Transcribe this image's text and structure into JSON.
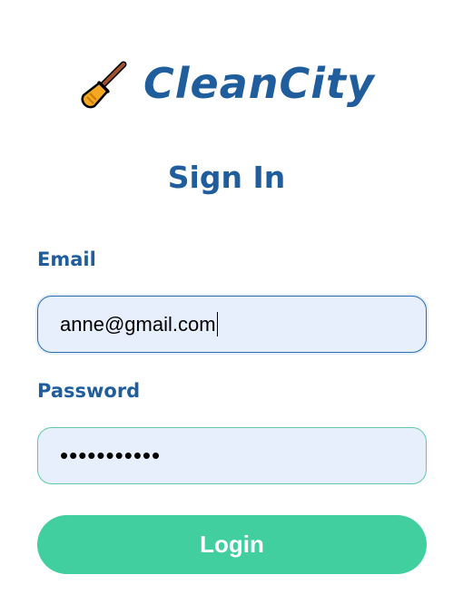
{
  "brand": {
    "icon": "broom-icon",
    "name": "CleanCity"
  },
  "form": {
    "heading": "Sign In",
    "email": {
      "label": "Email",
      "value": "anne@gmail.com"
    },
    "password": {
      "label": "Password",
      "value": "•••••••••••"
    },
    "submit_label": "Login"
  },
  "colors": {
    "brand_blue": "#1f5d9c",
    "input_bg": "#e8effc",
    "button_green": "#42cfa0"
  }
}
